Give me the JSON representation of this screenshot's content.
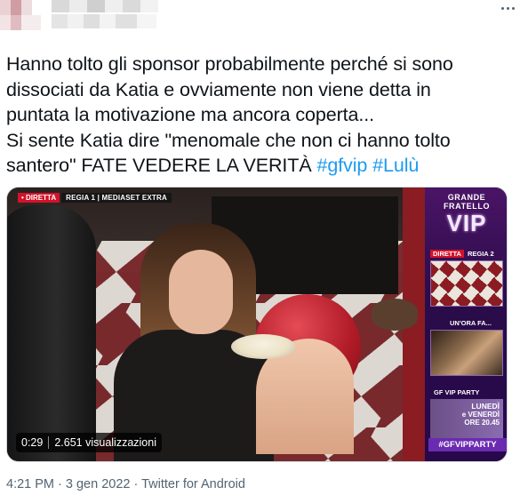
{
  "tweet": {
    "text_line1": "Hanno tolto gli sponsor probabilmente perché si sono",
    "text_line2": "dissociati da Katia e ovviamente non viene detta in",
    "text_line3": "puntata la motivazione ma ancora coperta...",
    "text_line4": "Si sente Katia dire \"menomale che non ci hanno tolto",
    "text_line5_plain": "santero\" FATE VEDERE LA VERITÀ ",
    "hashtags": [
      "#gfvip",
      "#Lulù"
    ]
  },
  "video": {
    "overlay": {
      "live_badge": "• DIRETTA",
      "channel_badge": "REGIA 1 | MEDIASET EXTRA"
    },
    "sidebar": {
      "logo_top": "GRANDE",
      "logo_mid": "FRATELLO",
      "logo_big": "VIP",
      "tag1_live": "DIRETTA",
      "tag1_label": "REGIA 2",
      "tag2_label": "UN'ORA FA...",
      "tag3_label": "GF VIP PARTY",
      "promo_line1": "LUNEDÌ",
      "promo_line2": "e VENERDÌ",
      "promo_line3": "ORE 20.45",
      "hashtag": "#GFVIPPARTY"
    },
    "duration": "0:29",
    "views": "2.651 visualizzazioni"
  },
  "footer": {
    "time": "4:21 PM",
    "dot": " · ",
    "date": "3 gen 2022",
    "dot2": " · ",
    "source": "Twitter for Android"
  }
}
